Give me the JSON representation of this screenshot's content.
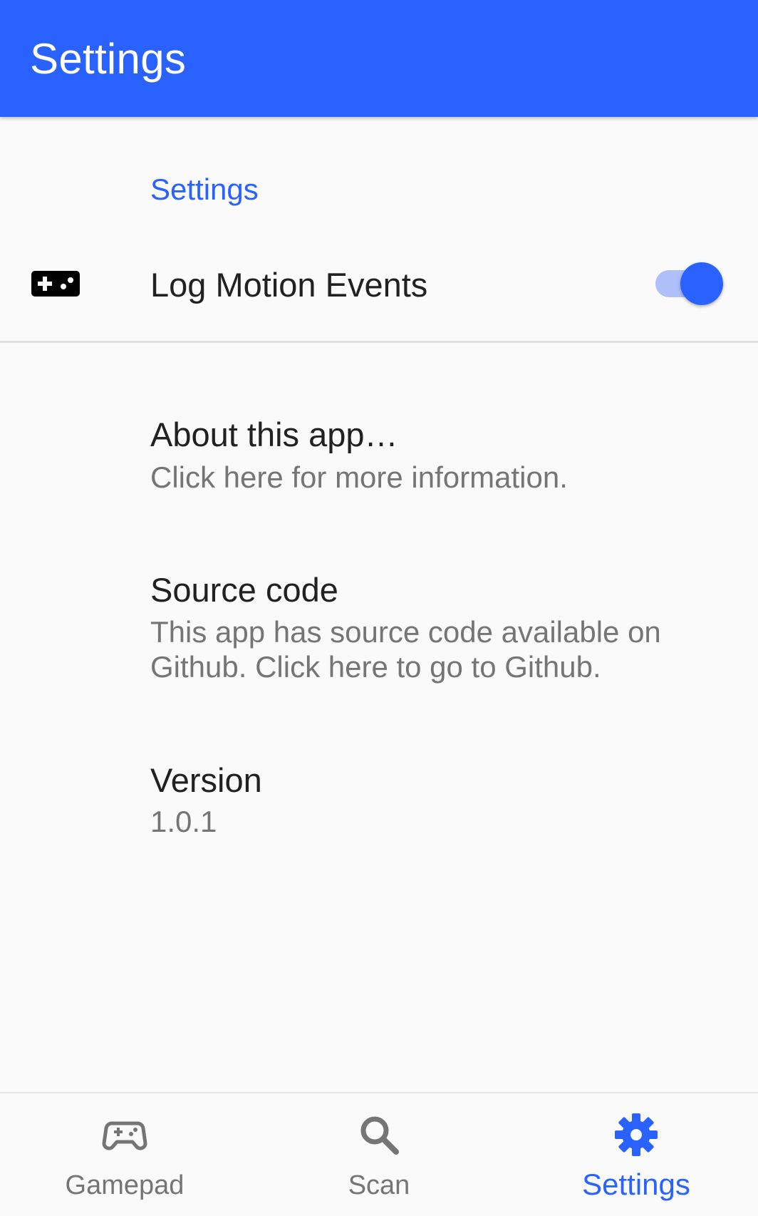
{
  "appbar": {
    "title": "Settings"
  },
  "category": {
    "title": "Settings"
  },
  "preferences": {
    "log_motion": {
      "title": "Log Motion Events",
      "icon": "gamepad-icon",
      "enabled": true
    },
    "about": {
      "title": "About this app…",
      "summary": "Click here for more information."
    },
    "source_code": {
      "title": "Source code",
      "summary": "This app has source code available on Github. Click here to go to Github."
    },
    "version": {
      "title": "Version",
      "summary": "1.0.1"
    }
  },
  "bottom_nav": {
    "items": [
      {
        "label": "Gamepad",
        "icon": "gamepad-icon",
        "active": false
      },
      {
        "label": "Scan",
        "icon": "search-icon",
        "active": false
      },
      {
        "label": "Settings",
        "icon": "gear-icon",
        "active": true
      }
    ]
  },
  "colors": {
    "primary": "#2962ff",
    "toggle_track": "#aebffa",
    "text_primary": "#212121",
    "text_secondary": "#757575",
    "background": "#fafafa"
  }
}
